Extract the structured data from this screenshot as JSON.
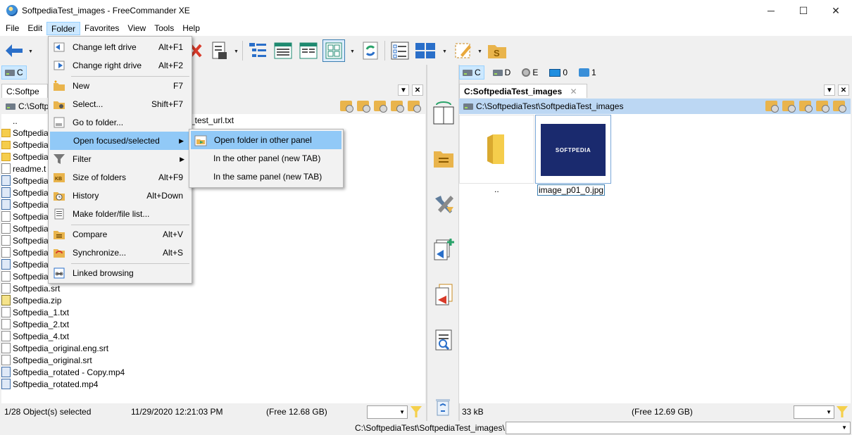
{
  "window": {
    "title": "SoftpediaTest_images - FreeCommander XE",
    "minimize": "─",
    "maximize": "☐",
    "close": "✕"
  },
  "menubar": [
    "File",
    "Edit",
    "Folder",
    "Favorites",
    "View",
    "Tools",
    "Help"
  ],
  "left": {
    "drive": "C",
    "tab_label": "C:Softpe",
    "path": "C:\\Softpe",
    "files": [
      {
        "name": "..",
        "kind": "up"
      },
      {
        "name": "Softpedia",
        "kind": "folder"
      },
      {
        "name": "Softpedia",
        "kind": "folder"
      },
      {
        "name": "Softpedia",
        "kind": "folder"
      },
      {
        "name": "readme.t",
        "kind": "file"
      },
      {
        "name": "Softpedia",
        "kind": "media"
      },
      {
        "name": "Softpedia",
        "kind": "media"
      },
      {
        "name": "Softpedia",
        "kind": "media"
      },
      {
        "name": "Softpedia",
        "kind": "file"
      },
      {
        "name": "Softpedia",
        "kind": "file"
      },
      {
        "name": "Softpedia",
        "kind": "file"
      },
      {
        "name": "Softpedia",
        "kind": "file"
      },
      {
        "name": "Softpedia",
        "kind": "media"
      },
      {
        "name": "Softpedia",
        "kind": "file"
      },
      {
        "name": "Softpedia.srt",
        "kind": "file"
      },
      {
        "name": "Softpedia.zip",
        "kind": "zip"
      },
      {
        "name": "Softpedia_1.txt",
        "kind": "file"
      },
      {
        "name": "Softpedia_2.txt",
        "kind": "file"
      },
      {
        "name": "Softpedia_4.txt",
        "kind": "file"
      },
      {
        "name": "Softpedia_original.eng.srt",
        "kind": "file"
      },
      {
        "name": "Softpedia_original.srt",
        "kind": "file"
      },
      {
        "name": "Softpedia_rotated - Copy.mp4",
        "kind": "media"
      },
      {
        "name": "Softpedia_rotated.mp4",
        "kind": "media"
      }
    ],
    "partial_filename": "_test_url.txt",
    "status": {
      "selected": "1/28 Object(s) selected",
      "datetime": "11/29/2020 12:21:03 PM",
      "free": "(Free 12.68 GB)"
    }
  },
  "right": {
    "drives": [
      {
        "label": "C",
        "kind": "hdd"
      },
      {
        "label": "D",
        "kind": "hdd"
      },
      {
        "label": "E",
        "kind": "cd"
      },
      {
        "label": "0",
        "kind": "monitor"
      },
      {
        "label": "1",
        "kind": "network"
      }
    ],
    "tab_label": "C:SoftpediaTest_images",
    "tab_close": "✕",
    "path": "C:\\SoftpediaTest\\SoftpediaTest_images",
    "thumbs": [
      {
        "name": "..",
        "kind": "folder"
      },
      {
        "name": "image_p01_0.jpg",
        "kind": "image",
        "logo": "SOFTPEDIA"
      }
    ],
    "status": {
      "size": "33 kB",
      "free": "(Free 12.69 GB)"
    }
  },
  "cmdline": {
    "path": "C:\\SoftpediaTest\\SoftpediaTest_images\\"
  },
  "folder_menu": {
    "items": [
      {
        "label": "Change left drive",
        "key": "Alt+F1",
        "icon": "arrow-left-icon"
      },
      {
        "label": "Change right drive",
        "key": "Alt+F2",
        "icon": "arrow-right-icon"
      },
      {
        "label": "New",
        "key": "F7",
        "icon": "new-folder-icon"
      },
      {
        "label": "Select...",
        "key": "Shift+F7",
        "icon": "select-folder-icon"
      },
      {
        "label": "Go to folder...",
        "key": "",
        "icon": "goto-folder-icon"
      },
      {
        "label": "Open focused/selected",
        "key": "",
        "icon": "",
        "submenu": true
      },
      {
        "label": "Filter",
        "key": "",
        "icon": "filter-icon",
        "submenu": true
      },
      {
        "label": "Size of folders",
        "key": "Alt+F9",
        "icon": "kb-icon"
      },
      {
        "label": "History",
        "key": "Alt+Down",
        "icon": "history-icon"
      },
      {
        "label": "Make folder/file list...",
        "key": "",
        "icon": "list-icon"
      },
      {
        "label": "Compare",
        "key": "Alt+V",
        "icon": "compare-icon"
      },
      {
        "label": "Synchronize...",
        "key": "Alt+S",
        "icon": "sync-icon"
      },
      {
        "label": "Linked browsing",
        "key": "",
        "icon": "link-icon"
      }
    ]
  },
  "submenu": {
    "items": [
      "Open folder in other panel",
      "In the other panel (new TAB)",
      "In the same panel (new TAB)"
    ]
  },
  "watermark": "SOFTPEDIA",
  "colors": {
    "selection": "#91c9f7",
    "path_active": "#bcd7f3",
    "accent": "#1f5fae"
  }
}
